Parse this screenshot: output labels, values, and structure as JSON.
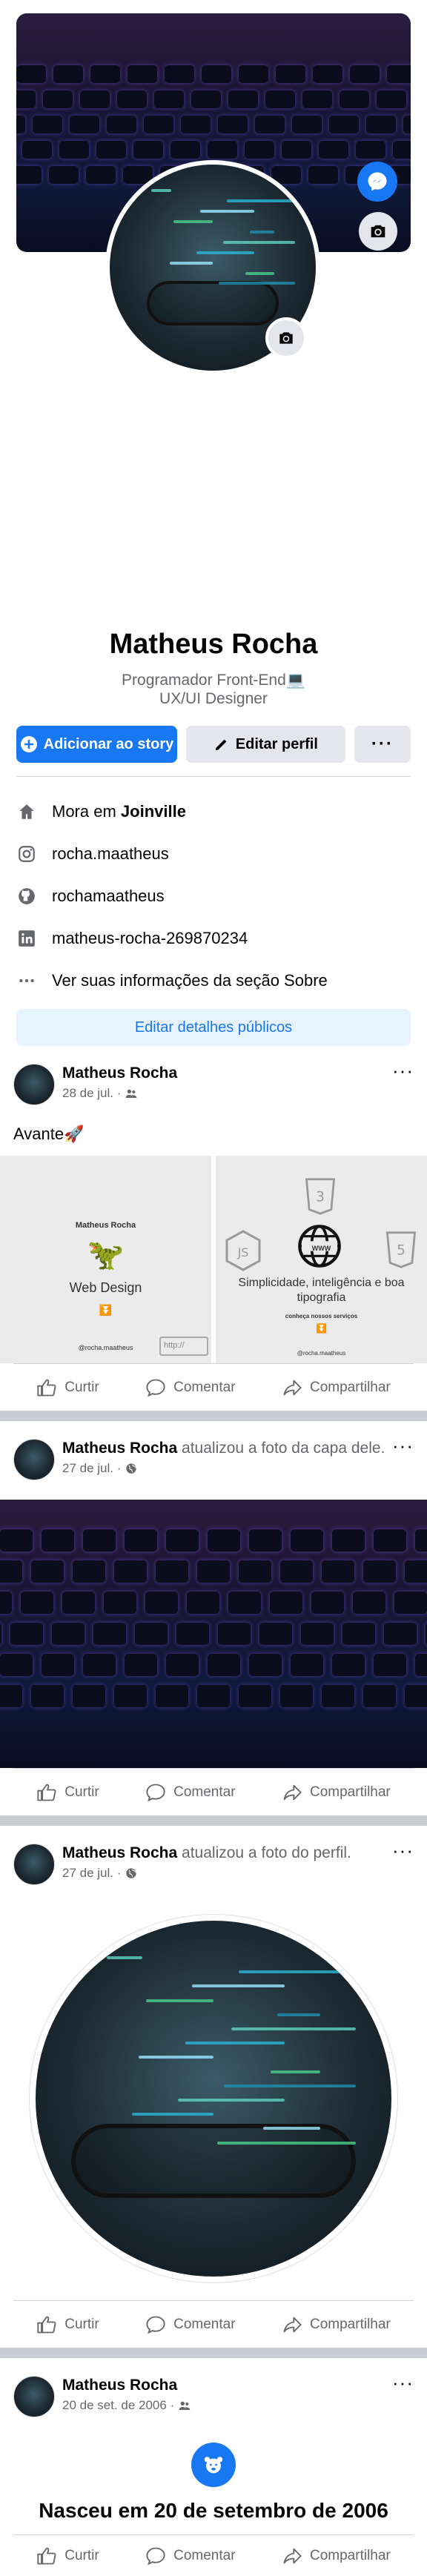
{
  "profile": {
    "name": "Matheus Rocha",
    "bio_line1": "Programador Front-End💻",
    "bio_line2": "UX/UI Designer"
  },
  "actions": {
    "add_story": "Adicionar ao story",
    "edit_profile": "Editar perfil",
    "more": "···"
  },
  "info": {
    "lives_prefix": "Mora em ",
    "lives_city": "Joinville",
    "instagram": "rocha.maatheus",
    "github": "rochamaatheus",
    "linkedin": "matheus-rocha-269870234",
    "about": "Ver suas informações da seção Sobre"
  },
  "edit_public": "Editar detalhes públicos",
  "post_bar": {
    "like": "Curtir",
    "comment": "Comentar",
    "share": "Compartilhar"
  },
  "posts": [
    {
      "author": "Matheus Rocha",
      "date": "28 de jul. ·",
      "text": "Avante🚀",
      "left_panel": {
        "title": "Matheus Rocha",
        "subtitle": "Web Design",
        "handle": "@rocha.maatheus",
        "url": "http://"
      },
      "right_panel": {
        "headline": "Simplicidade, inteligência e boa tipografia",
        "cta": "conheça nossos serviços",
        "handle": "@rocha.maatheus",
        "www": "WWW"
      }
    },
    {
      "author": "Matheus Rocha",
      "action": " atualizou a foto da capa dele.",
      "date": "27 de jul. ·"
    },
    {
      "author": "Matheus Rocha",
      "action": " atualizou a foto do perfil.",
      "date": "27 de jul. ·"
    },
    {
      "author": "Matheus Rocha",
      "date": "20 de set. de 2006 ·",
      "event": "Nasceu em 20 de setembro de 2006"
    }
  ],
  "colors": {
    "accent": "#1877f2",
    "muted": "#65676b",
    "light_button": "#e4e6eb",
    "separator": "#c9ccd1"
  }
}
